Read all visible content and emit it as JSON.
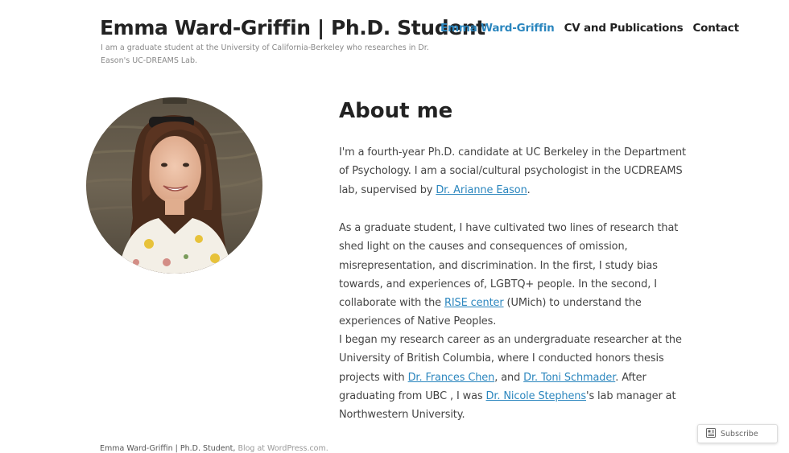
{
  "site": {
    "title": "Emma Ward-Griffin | Ph.D. Student",
    "description": "I am a graduate student at the University of California-Berkeley who researches in Dr. Eason's UC-DREAMS Lab."
  },
  "nav": {
    "items": [
      {
        "label": "Emma Ward-Griffin",
        "current": true
      },
      {
        "label": "CV and Publications",
        "current": false
      },
      {
        "label": "Contact",
        "current": false
      }
    ]
  },
  "main": {
    "heading": "About me",
    "p1": {
      "text_before": "I'm a fourth-year Ph.D. candidate at UC Berkeley in the Department of Psychology. I am a social/cultural psychologist in the UCDREAMS lab, supervised by ",
      "link": "Dr. Arianne Eason",
      "text_after": "."
    },
    "p2": {
      "text_before": "As a graduate student, I have cultivated two lines of research that shed light on the causes and consequences of omission, misrepresentation, and discrimination. In the first, I study bias towards, and experiences of, LGBTQ+ people. In the second, I collaborate with the ",
      "link": "RISE center",
      "text_after": " (UMich) to understand the experiences of Native Peoples."
    },
    "p3": {
      "text_before": "I began my research career as an undergraduate researcher at the University of British Columbia, where I conducted honors thesis projects with ",
      "link1": "Dr. Frances Chen",
      "text_mid1": ", and ",
      "link2": "Dr. Toni Schmader",
      "text_mid2": ". After graduating from UBC , I was ",
      "link3": "Dr. Nicole Stephens",
      "text_after": "'s lab manager at Northwestern University."
    }
  },
  "footer": {
    "credit": "Emma Ward-Griffin | Ph.D. Student,",
    "powered": "Blog at WordPress.com."
  },
  "subscribe": {
    "label": "Subscribe",
    "icon": "reader-icon"
  },
  "colors": {
    "link": "#2b86be",
    "title": "#222222",
    "body_text": "#444444"
  }
}
